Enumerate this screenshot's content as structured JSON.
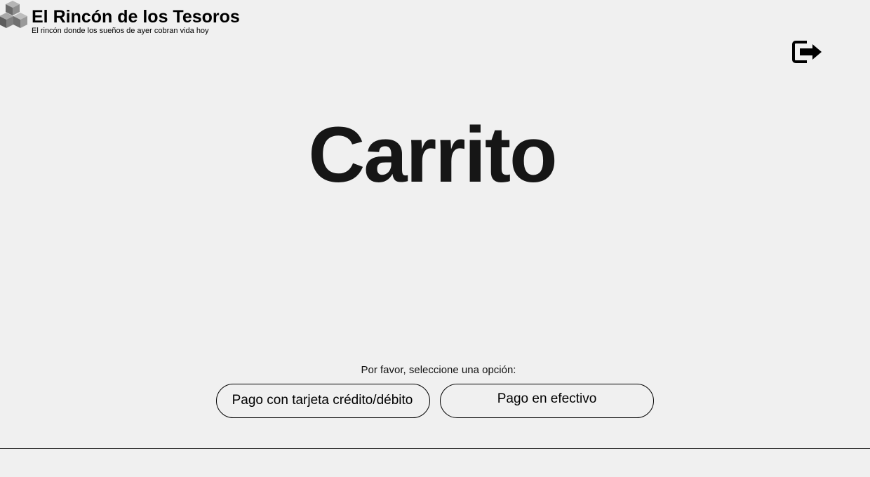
{
  "brand": {
    "title": "El Rincón de los Tesoros",
    "tagline": "El rincón donde los sueños de ayer cobran vida hoy",
    "logo_icon": "stacked-cubes-logo"
  },
  "header": {
    "logout_icon": "logout-icon"
  },
  "main": {
    "title": "Carrito"
  },
  "payment": {
    "prompt": "Por favor, seleccione una opción:",
    "options": [
      {
        "label": "Pago con tarjeta crédito/débito"
      },
      {
        "label": "Pago en efectivo"
      }
    ]
  },
  "colors": {
    "background": "#f0f0f0",
    "text": "#000000",
    "title": "#161616",
    "logo_dark": "#5a5a5a",
    "logo_light": "#9a9a9a"
  }
}
